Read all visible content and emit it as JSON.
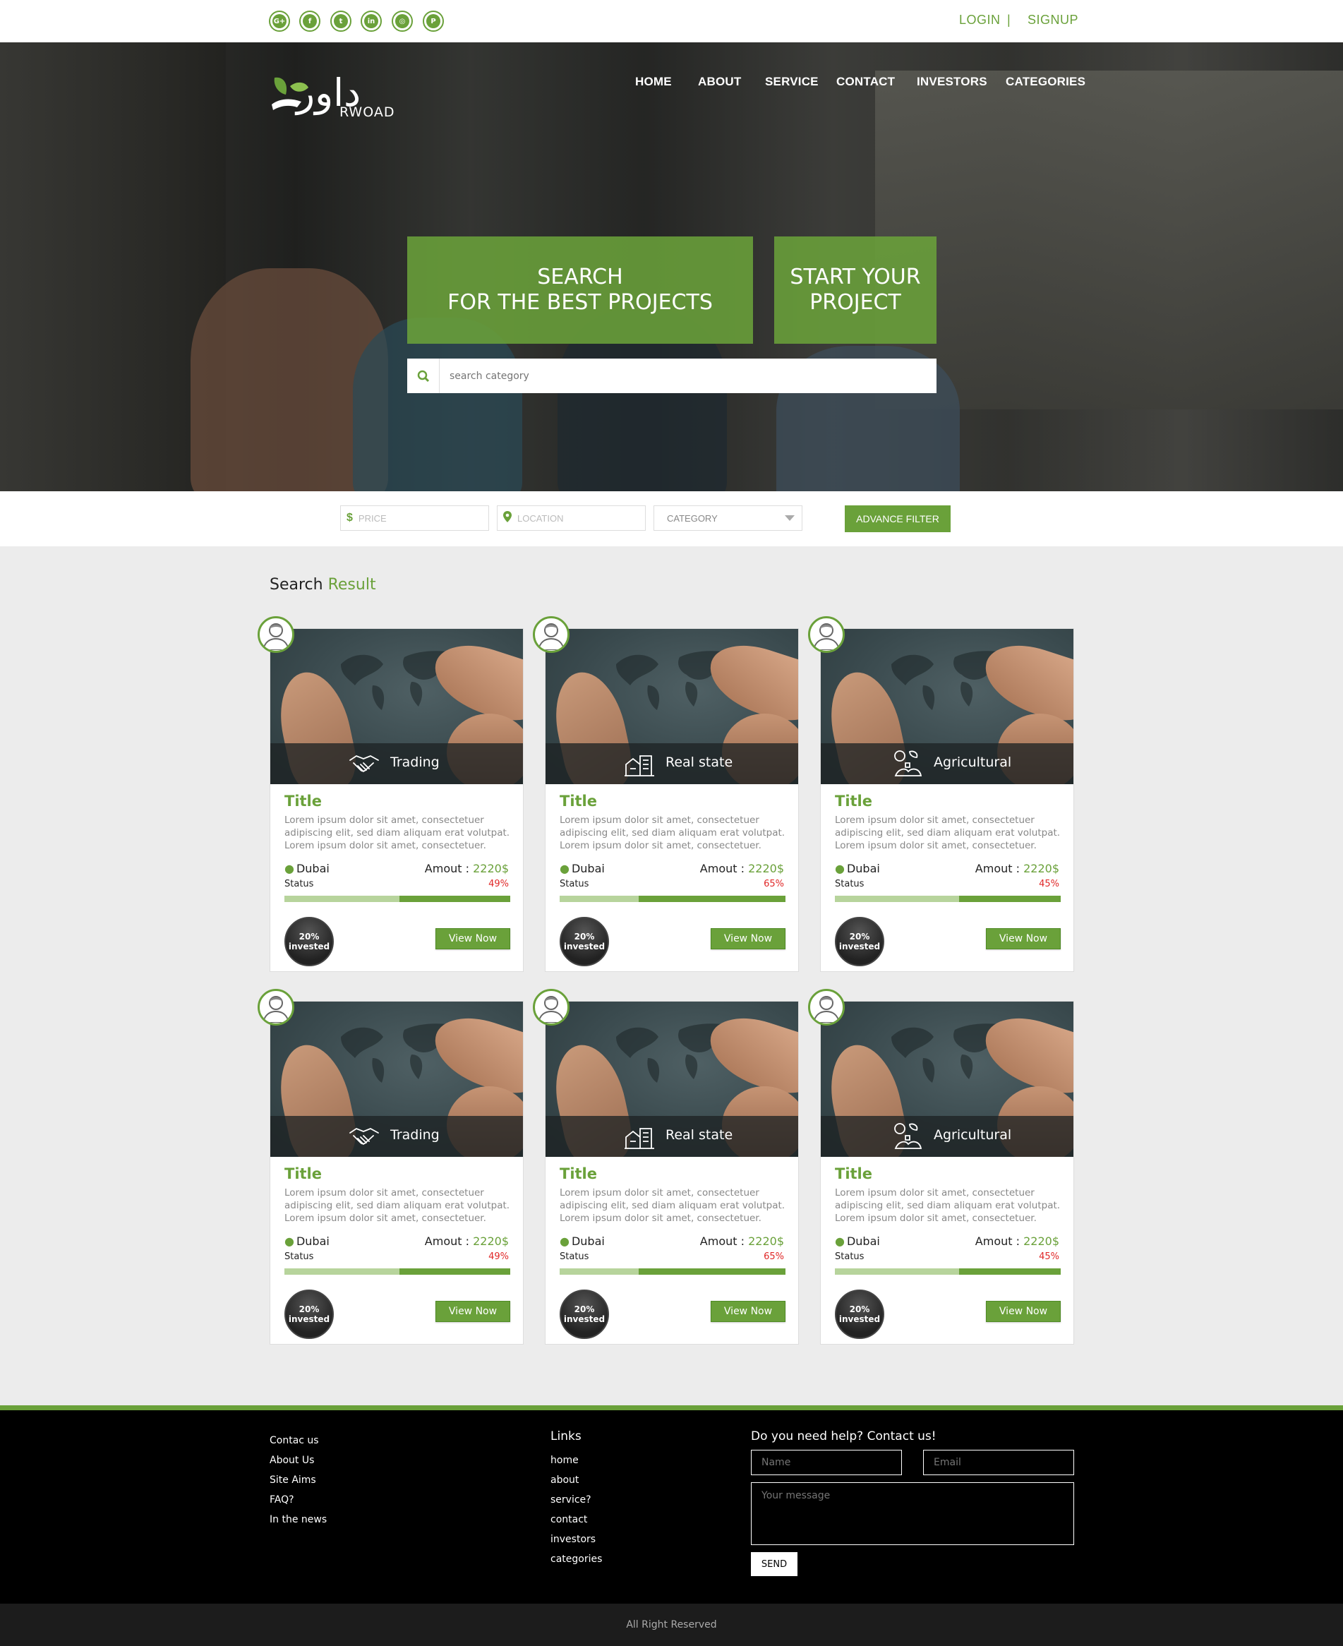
{
  "brand": {
    "name_ar": "داور",
    "name_en": "RWOAD"
  },
  "topbar": {
    "social": [
      {
        "icon": "google-plus-icon",
        "glyph": "G+"
      },
      {
        "icon": "facebook-icon",
        "glyph": "f"
      },
      {
        "icon": "twitter-icon",
        "glyph": "t"
      },
      {
        "icon": "linkedin-icon",
        "glyph": "in"
      },
      {
        "icon": "instagram-icon",
        "glyph": "◎"
      },
      {
        "icon": "pinterest-icon",
        "glyph": "P"
      }
    ],
    "login": "LOGIN",
    "separator": "|",
    "signup": "SIGNUP"
  },
  "nav": [
    "HOME",
    "ABOUT",
    "SERVICE",
    "CONTACT",
    "INVESTORS",
    "CATEGORIES"
  ],
  "hero": {
    "search_line1": "SEARCH",
    "search_line2": "FOR THE BEST PROJECTS",
    "start_line1": "START YOUR",
    "start_line2": "PROJECT",
    "search_placeholder": "search category"
  },
  "filters": {
    "price_placeholder": "PRICE",
    "location_placeholder": "LOCATION",
    "category": "CATEGORY",
    "advance_button": "ADVANCE FILTER"
  },
  "results": {
    "title_part1": "Search",
    "title_part2": "Result",
    "cards": [
      {
        "category": "Trading",
        "title": "Title",
        "desc": "Lorem ipsum dolor sit amet, consectetuer adipiscing elit, sed diam aliquam erat volutpat. Lorem ipsum dolor sit amet, consectetuer.",
        "location": "Dubai",
        "amount_label": "Amout :",
        "amount": "2220$",
        "status_label": "Status",
        "percent": "49%",
        "progress": 0.49,
        "invested_pct": "20%",
        "invested_label": "invested",
        "button": "View Now"
      },
      {
        "category": "Real state",
        "title": "Title",
        "desc": "Lorem ipsum dolor sit amet, consectetuer adipiscing elit, sed diam aliquam erat volutpat. Lorem ipsum dolor sit amet, consectetuer.",
        "location": "Dubai",
        "amount_label": "Amout :",
        "amount": "2220$",
        "status_label": "Status",
        "percent": "65%",
        "progress": 0.65,
        "invested_pct": "20%",
        "invested_label": "invested",
        "button": "View Now"
      },
      {
        "category": "Agricultural",
        "title": "Title",
        "desc": "Lorem ipsum dolor sit amet, consectetuer adipiscing elit, sed diam aliquam erat volutpat. Lorem ipsum dolor sit amet, consectetuer.",
        "location": "Dubai",
        "amount_label": "Amout :",
        "amount": "2220$",
        "status_label": "Status",
        "percent": "45%",
        "progress": 0.45,
        "invested_pct": "20%",
        "invested_label": "invested",
        "button": "View Now"
      },
      {
        "category": "Trading",
        "title": "Title",
        "desc": "Lorem ipsum dolor sit amet, consectetuer adipiscing elit, sed diam aliquam erat volutpat. Lorem ipsum dolor sit amet, consectetuer.",
        "location": "Dubai",
        "amount_label": "Amout :",
        "amount": "2220$",
        "status_label": "Status",
        "percent": "49%",
        "progress": 0.49,
        "invested_pct": "20%",
        "invested_label": "invested",
        "button": "View Now"
      },
      {
        "category": "Real state",
        "title": "Title",
        "desc": "Lorem ipsum dolor sit amet, consectetuer adipiscing elit, sed diam aliquam erat volutpat. Lorem ipsum dolor sit amet, consectetuer.",
        "location": "Dubai",
        "amount_label": "Amout :",
        "amount": "2220$",
        "status_label": "Status",
        "percent": "65%",
        "progress": 0.65,
        "invested_pct": "20%",
        "invested_label": "invested",
        "button": "View Now"
      },
      {
        "category": "Agricultural",
        "title": "Title",
        "desc": "Lorem ipsum dolor sit amet, consectetuer adipiscing elit, sed diam aliquam erat volutpat. Lorem ipsum dolor sit amet, consectetuer.",
        "location": "Dubai",
        "amount_label": "Amout :",
        "amount": "2220$",
        "status_label": "Status",
        "percent": "45%",
        "progress": 0.45,
        "invested_pct": "20%",
        "invested_label": "invested",
        "button": "View Now"
      }
    ]
  },
  "footer": {
    "col1": [
      "Contac us",
      "About Us",
      "Site Aims",
      "FAQ?",
      "In the news"
    ],
    "links_heading": "Links",
    "links": [
      "home",
      "about",
      "service?",
      "contact",
      "investors",
      "categories"
    ],
    "contact_heading": "Do you need help? Contact us!",
    "name_placeholder": "Name",
    "email_placeholder": "Email",
    "message_placeholder": "Your message",
    "send": "SEND",
    "copyright": "All Right Reserved"
  },
  "colors": {
    "accent": "#6aa13a",
    "dark": "#000000",
    "alert": "#e02828"
  }
}
